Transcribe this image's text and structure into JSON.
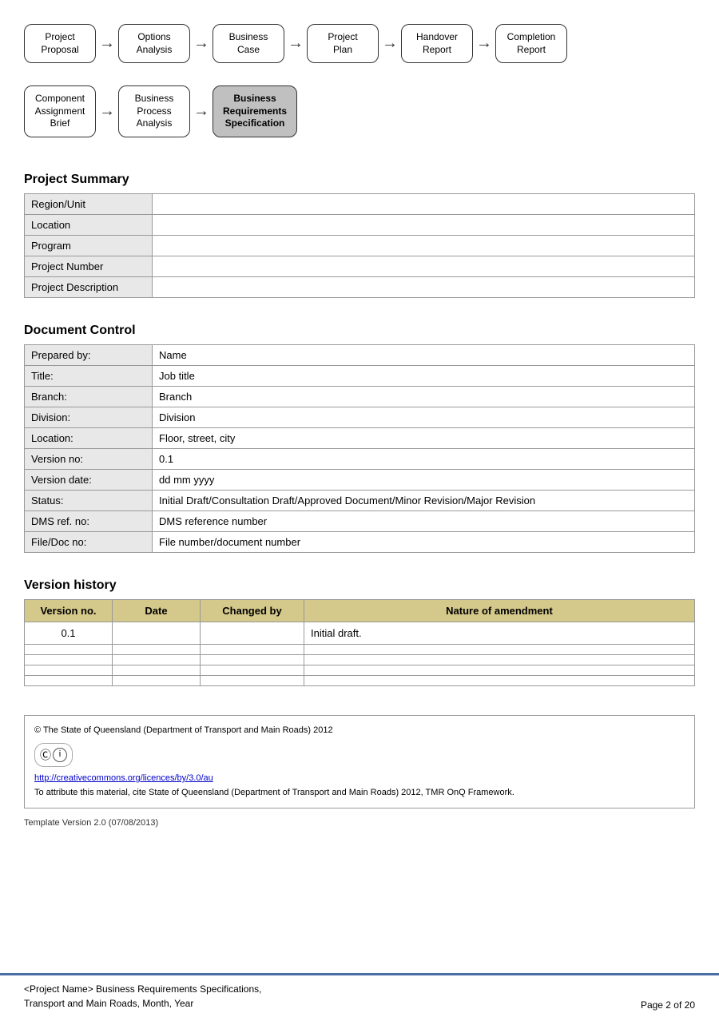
{
  "flow1": {
    "nodes": [
      {
        "id": "node-project-proposal",
        "label": "Project\nProposal",
        "active": false
      },
      {
        "id": "node-options-analysis",
        "label": "Options\nAnalysis",
        "active": false
      },
      {
        "id": "node-business-case",
        "label": "Business\nCase",
        "active": false
      },
      {
        "id": "node-project-plan",
        "label": "Project\nPlan",
        "active": false
      },
      {
        "id": "node-handover-report",
        "label": "Handover\nReport",
        "active": false
      },
      {
        "id": "node-completion-report",
        "label": "Completion\nReport",
        "active": false
      }
    ]
  },
  "flow2": {
    "nodes": [
      {
        "id": "node-component-assignment",
        "label": "Component\nAssignment\nBrief",
        "active": false
      },
      {
        "id": "node-business-process",
        "label": "Business\nProcess\nAnalysis",
        "active": false
      },
      {
        "id": "node-business-req",
        "label": "Business\nRequirements\nSpecification",
        "active": true
      }
    ]
  },
  "project_summary": {
    "title": "Project Summary",
    "rows": [
      {
        "label": "Region/Unit",
        "value": ""
      },
      {
        "label": "Location",
        "value": ""
      },
      {
        "label": "Program",
        "value": ""
      },
      {
        "label": "Project Number",
        "value": ""
      },
      {
        "label": "Project Description",
        "value": ""
      }
    ]
  },
  "document_control": {
    "title": "Document Control",
    "rows": [
      {
        "label": "Prepared by:",
        "value": "Name"
      },
      {
        "label": "Title:",
        "value": "Job title"
      },
      {
        "label": "Branch:",
        "value": "Branch"
      },
      {
        "label": "Division:",
        "value": "Division"
      },
      {
        "label": "Location:",
        "value": "Floor, street, city"
      },
      {
        "label": "Version no:",
        "value": "0.1"
      },
      {
        "label": "Version date:",
        "value": "dd mm yyyy"
      },
      {
        "label": "Status:",
        "value": "Initial Draft/Consultation Draft/Approved Document/Minor Revision/Major Revision"
      },
      {
        "label": "DMS ref. no:",
        "value": "DMS reference number"
      },
      {
        "label": "File/Doc no:",
        "value": "File number/document number"
      }
    ]
  },
  "version_history": {
    "title": "Version history",
    "headers": [
      "Version no.",
      "Date",
      "Changed by",
      "Nature of amendment"
    ],
    "rows": [
      {
        "version": "0.1",
        "date": "",
        "changed_by": "",
        "nature": "Initial draft."
      },
      {
        "version": "",
        "date": "",
        "changed_by": "",
        "nature": ""
      },
      {
        "version": "",
        "date": "",
        "changed_by": "",
        "nature": ""
      },
      {
        "version": "",
        "date": "",
        "changed_by": "",
        "nature": ""
      },
      {
        "version": "",
        "date": "",
        "changed_by": "",
        "nature": ""
      }
    ]
  },
  "footer": {
    "copyright": "© The State of Queensland (Department of Transport and Main Roads) 2012",
    "cc_symbols": "©",
    "link_text": "http://creativecommons.org/licences/by/3.0/au",
    "attribution": "To attribute this material, cite State of Queensland (Department of Transport and Main Roads) 2012, TMR OnQ Framework.",
    "template_version": "Template Version 2.0 (07/08/2013)"
  },
  "page_bottom": {
    "doc_title_line1": "<Project Name> Business Requirements Specifications,",
    "doc_title_line2": "Transport and Main Roads, Month, Year",
    "page_label": "Page 2 of 20"
  }
}
